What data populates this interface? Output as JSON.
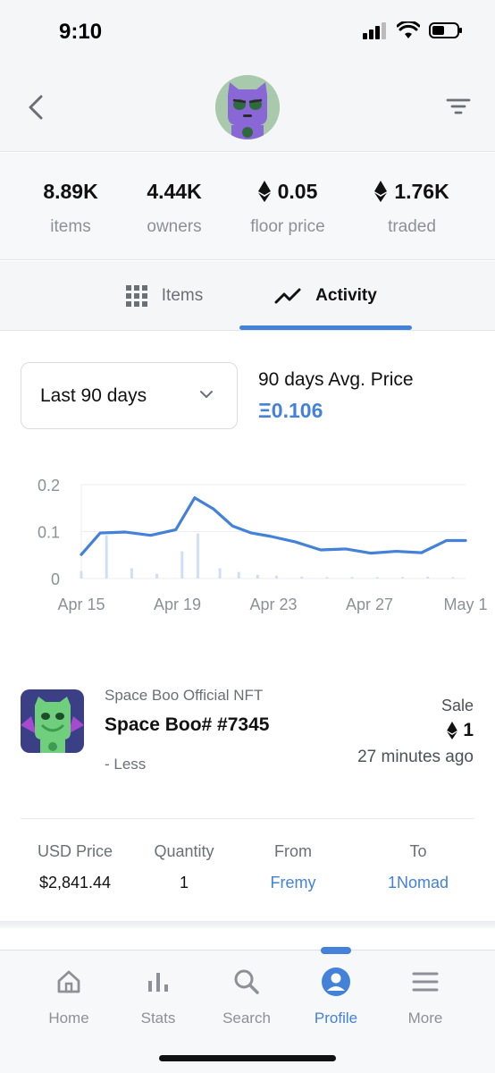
{
  "status_bar": {
    "time": "9:10"
  },
  "stats": [
    {
      "value": "8.89K",
      "label": "items",
      "eth": false
    },
    {
      "value": "4.44K",
      "label": "owners",
      "eth": false
    },
    {
      "value": "0.05",
      "label": "floor price",
      "eth": true
    },
    {
      "value": "1.76K",
      "label": "traded",
      "eth": true
    }
  ],
  "tabs": {
    "items_label": "Items",
    "activity_label": "Activity",
    "active": "Activity"
  },
  "range": {
    "selected": "Last 90 days"
  },
  "avg": {
    "title": "90 days Avg. Price",
    "value": "Ξ0.106"
  },
  "chart_data": {
    "type": "line",
    "x": [
      "Apr 15",
      "Apr 16",
      "Apr 17",
      "Apr 18",
      "Apr 19",
      "Apr 19.5",
      "Apr 20",
      "Apr 21",
      "Apr 22",
      "Apr 23",
      "Apr 24",
      "Apr 25",
      "Apr 26",
      "Apr 27",
      "Apr 28",
      "Apr 29",
      "Apr 30",
      "May 1"
    ],
    "xs": [
      0,
      0.6,
      1.4,
      2.2,
      3.0,
      3.6,
      4.2,
      4.8,
      5.4,
      6.0,
      6.8,
      7.6,
      8.4,
      9.2,
      10.0,
      10.8,
      11.6,
      12.2
    ],
    "series": [
      {
        "name": "",
        "values": [
          0.051,
          0.097,
          0.099,
          0.092,
          0.104,
          0.172,
          0.148,
          0.112,
          0.097,
          0.09,
          0.078,
          0.061,
          0.063,
          0.054,
          0.058,
          0.055,
          0.081,
          0.081
        ]
      }
    ],
    "volume_bars": {
      "xs": [
        0,
        0.8,
        1.6,
        2.4,
        3.2,
        3.7,
        4.4,
        5.0,
        5.6,
        6.2,
        7.0,
        7.8,
        8.6,
        9.4,
        10.2,
        11.0,
        11.8
      ],
      "values": [
        0.016,
        0.092,
        0.022,
        0.01,
        0.058,
        0.096,
        0.022,
        0.014,
        0.008,
        0.006,
        0.004,
        0.003,
        0.003,
        0.003,
        0.003,
        0.004,
        0.003
      ]
    },
    "x_ticks": [
      {
        "label": "Apr 15",
        "x": 0
      },
      {
        "label": "Apr 19",
        "x": 4
      },
      {
        "label": "Apr 23",
        "x": 8
      },
      {
        "label": "Apr 27",
        "x": 12
      },
      {
        "label": "May 1",
        "x": 16
      }
    ],
    "y_ticks": [
      "0",
      "0.1",
      "0.2"
    ],
    "ylim": [
      0,
      0.2
    ],
    "xlim": [
      0,
      16
    ],
    "grid": true,
    "color": "#4481d8",
    "bar_color": "#cfe0f6"
  },
  "event": {
    "collection": "Space Boo Official NFT",
    "name": "Space Boo# #7345",
    "toggle": "- Less",
    "type": "Sale",
    "price": "1",
    "time": "27 minutes ago"
  },
  "details": {
    "usd_label": "USD Price",
    "usd_value": "$2,841.44",
    "qty_label": "Quantity",
    "qty_value": "1",
    "from_label": "From",
    "from_value": "Fremy",
    "to_label": "To",
    "to_value": "1Nomad"
  },
  "nav": [
    {
      "label": "Home",
      "icon": "home-icon"
    },
    {
      "label": "Stats",
      "icon": "stats-icon"
    },
    {
      "label": "Search",
      "icon": "search-icon"
    },
    {
      "label": "Profile",
      "icon": "profile-icon",
      "active": true
    },
    {
      "label": "More",
      "icon": "menu-icon"
    }
  ],
  "colors": {
    "accent": "#4481d8"
  }
}
